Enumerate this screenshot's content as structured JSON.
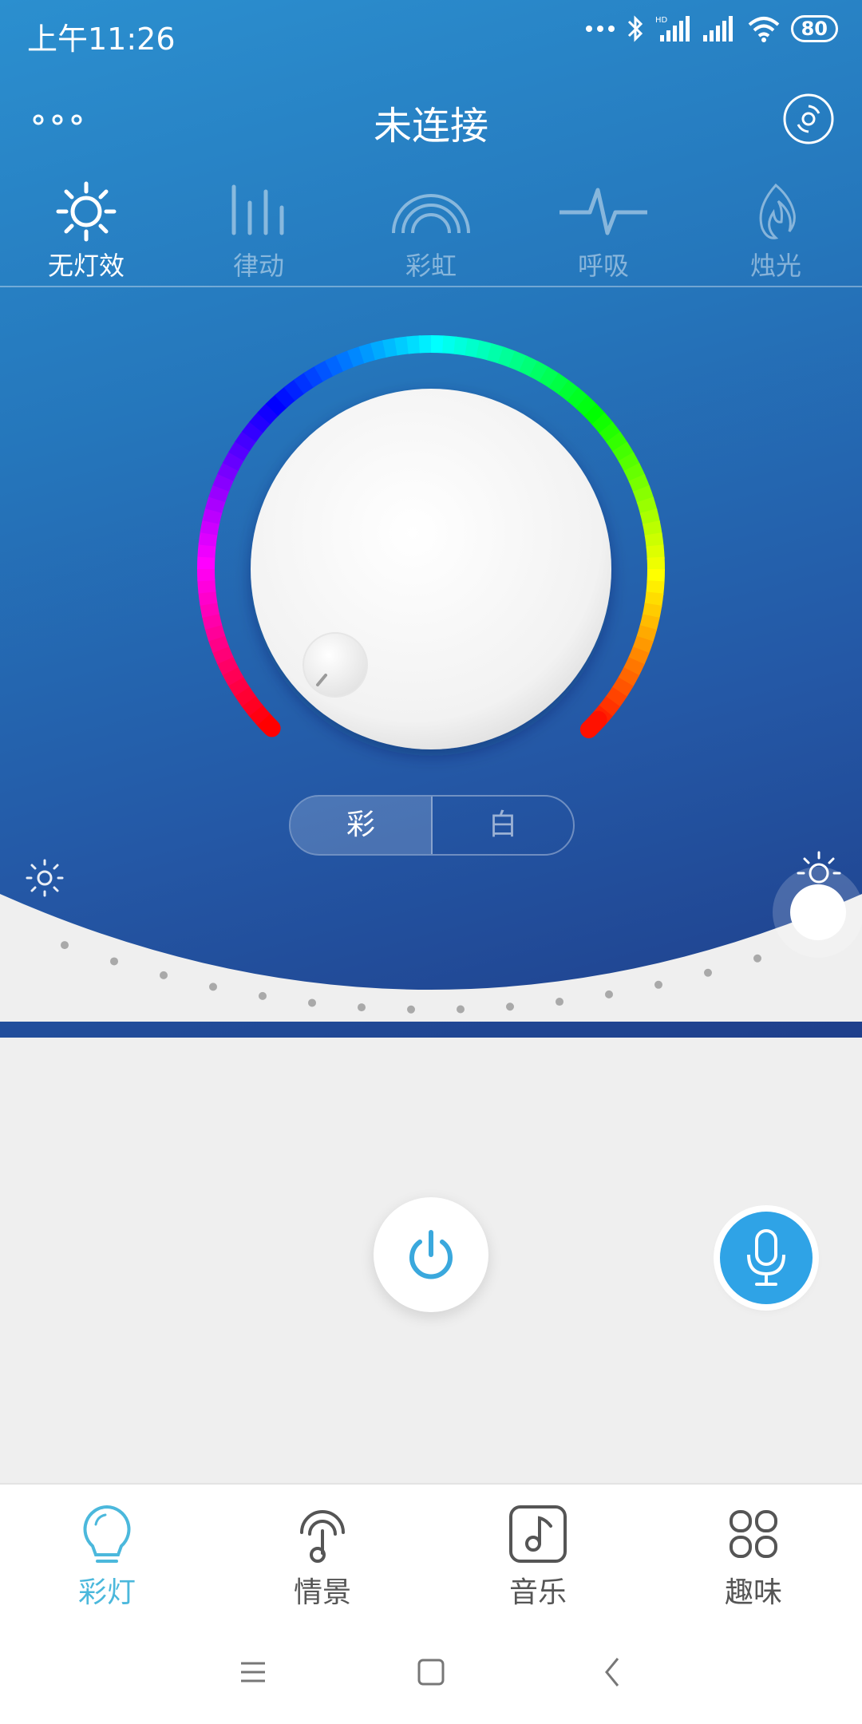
{
  "status_bar": {
    "time": "上午11:26",
    "battery": "80"
  },
  "header": {
    "title": "未连接"
  },
  "effects": [
    {
      "label": "无灯效",
      "icon": "sun-icon",
      "active": true
    },
    {
      "label": "律动",
      "icon": "equalizer-icon",
      "active": false
    },
    {
      "label": "彩虹",
      "icon": "rainbow-icon",
      "active": false
    },
    {
      "label": "呼吸",
      "icon": "pulse-icon",
      "active": false
    },
    {
      "label": "烛光",
      "icon": "flame-icon",
      "active": false
    }
  ],
  "mode_toggle": {
    "color_label": "彩",
    "white_label": "白",
    "selected": "彩"
  },
  "brightness": {
    "level": 1.0
  },
  "tabs": [
    {
      "label": "彩灯",
      "icon": "bulb-icon",
      "active": true
    },
    {
      "label": "情景",
      "icon": "touch-icon",
      "active": false
    },
    {
      "label": "音乐",
      "icon": "music-note-icon",
      "active": false
    },
    {
      "label": "趣味",
      "icon": "grid-icon",
      "active": false
    }
  ],
  "colors": {
    "accent": "#4bb8dc",
    "mic": "#2fa3e6",
    "hero_top": "#2b8fcf",
    "hero_bottom": "#1f3f8b"
  }
}
